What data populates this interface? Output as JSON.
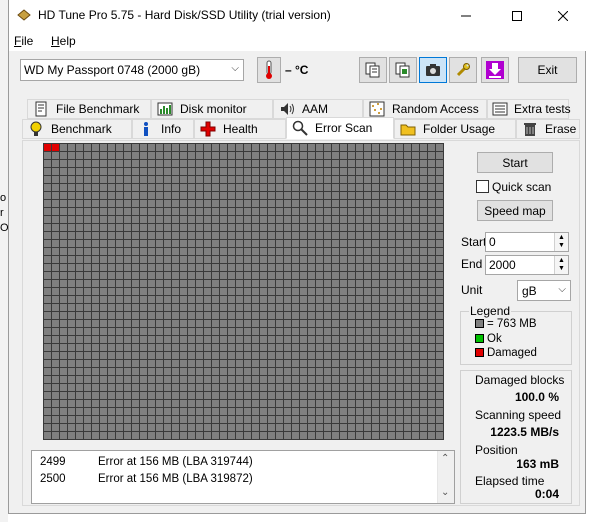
{
  "window": {
    "title": "HD Tune Pro 5.75 - Hard Disk/SSD Utility (trial version)"
  },
  "menu": {
    "file": "File",
    "help": "Help"
  },
  "toolbar": {
    "drive": "WD      My Passport 0748 (2000 gB)",
    "temperature": "– °C",
    "exit_label": "Exit"
  },
  "tabs_row1": [
    {
      "label": "File Benchmark",
      "icon": "file-benchmark-icon"
    },
    {
      "label": "Disk monitor",
      "icon": "disk-monitor-icon"
    },
    {
      "label": "AAM",
      "icon": "speaker-icon"
    },
    {
      "label": "Random Access",
      "icon": "random-access-icon"
    },
    {
      "label": "Extra tests",
      "icon": "extra-tests-icon"
    }
  ],
  "tabs_row2": [
    {
      "label": "Benchmark",
      "icon": "lightbulb-icon"
    },
    {
      "label": "Info",
      "icon": "info-icon"
    },
    {
      "label": "Health",
      "icon": "health-cross-icon"
    },
    {
      "label": "Error Scan",
      "icon": "magnifier-icon",
      "active": true
    },
    {
      "label": "Folder Usage",
      "icon": "folder-icon"
    },
    {
      "label": "Erase",
      "icon": "trash-icon"
    }
  ],
  "scan_grid": {
    "cols": 50,
    "rows": 37,
    "damaged_blocks": 2,
    "colors": {
      "unscanned": "#808080",
      "ok": "#00c000",
      "damaged": "#e00000",
      "border": "#3a3a3a"
    }
  },
  "log": [
    {
      "num": "2499",
      "text": "Error at 156 MB (LBA 319744)"
    },
    {
      "num": "2500",
      "text": "Error at 156 MB (LBA 319872)"
    }
  ],
  "controls": {
    "start_button": "Start",
    "quick_scan_label": "Quick scan",
    "quick_scan_checked": false,
    "speed_map_button": "Speed map",
    "start_label": "Start",
    "start_value": "0",
    "end_label": "End",
    "end_value": "2000",
    "unit_label": "Unit",
    "unit_value": "gB"
  },
  "legend": {
    "title": "Legend",
    "block_size": "= 763 MB",
    "ok": "Ok",
    "damaged": "Damaged"
  },
  "stats": {
    "damaged_blocks_label": "Damaged blocks",
    "damaged_blocks_value": "100.0 %",
    "scanning_speed_label": "Scanning speed",
    "scanning_speed_value": "1223.5 MB/s",
    "position_label": "Position",
    "position_value": "163 mB",
    "elapsed_label": "Elapsed time",
    "elapsed_value": "0:04"
  }
}
